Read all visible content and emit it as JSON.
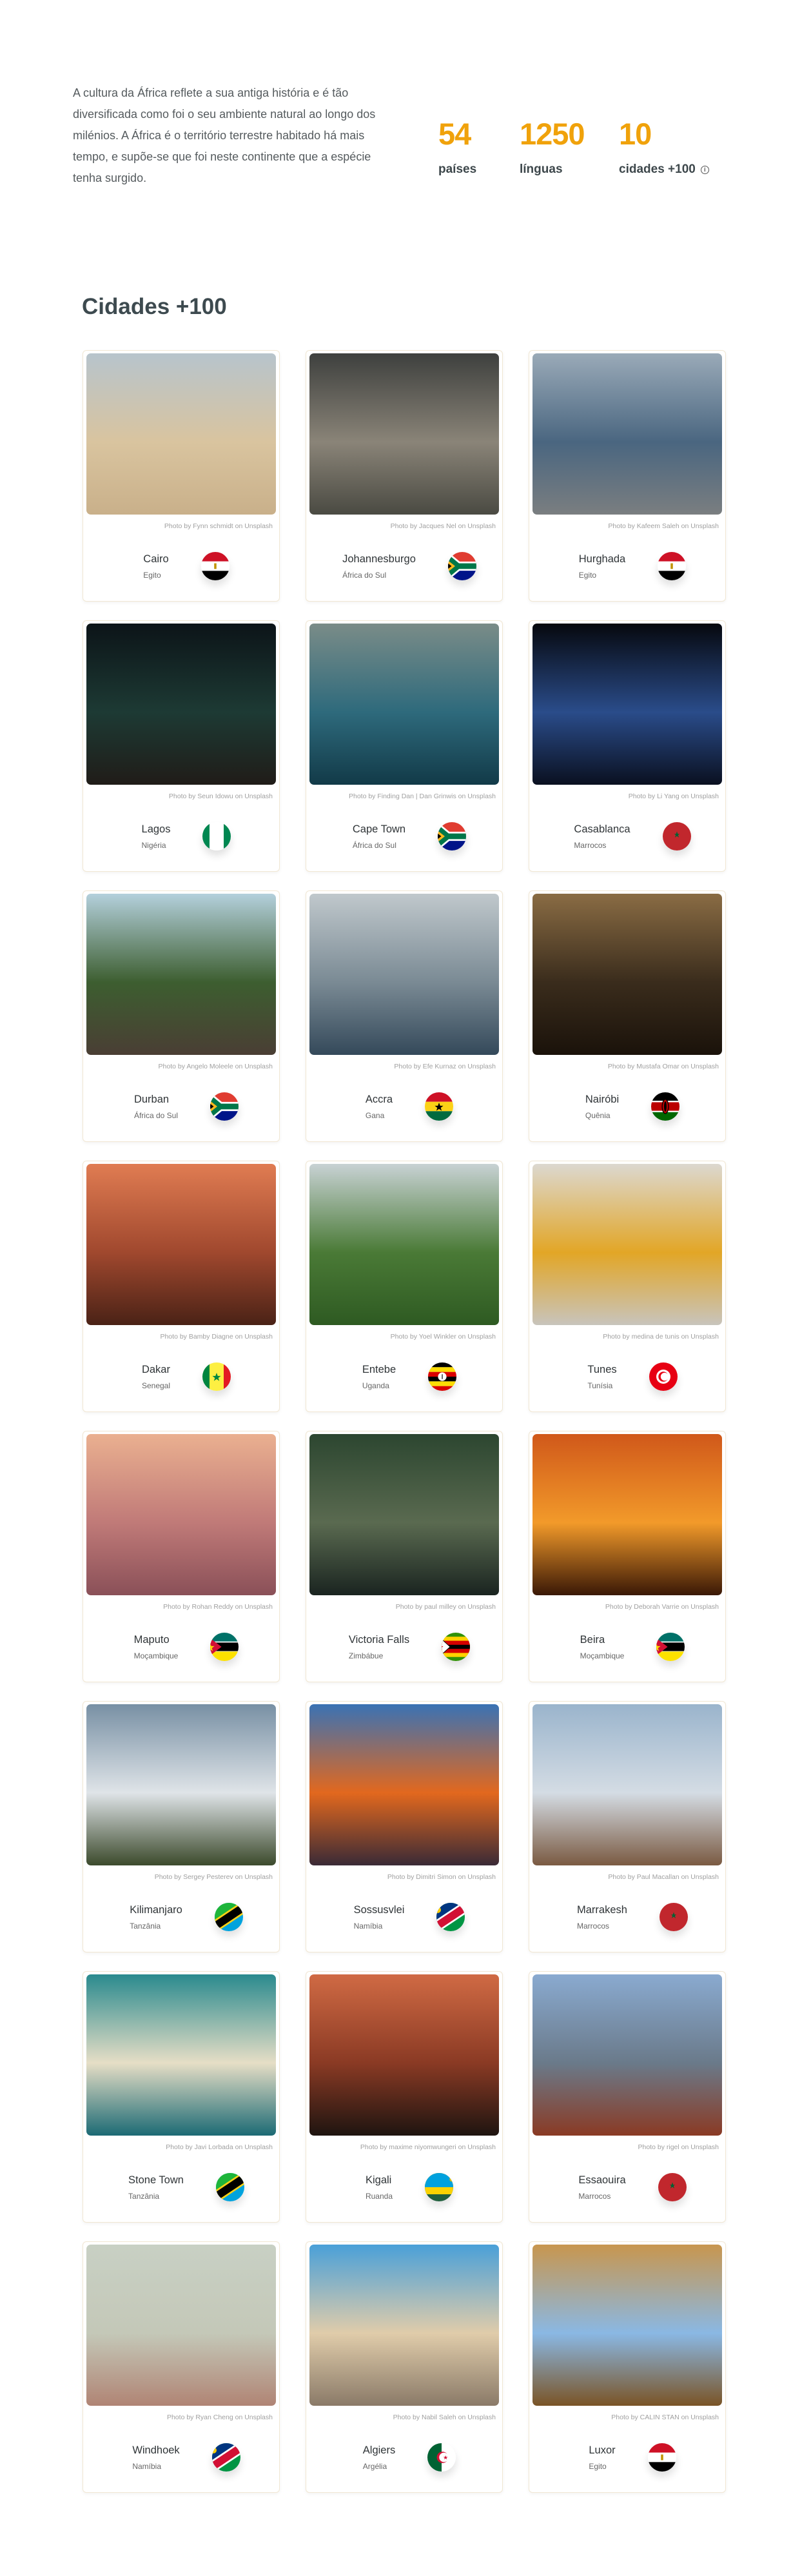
{
  "intro": {
    "text": "A cultura da África reflete a sua antiga história e é tão diversificada como foi o seu ambiente natural ao longo dos milénios. A África é o território terrestre habitado há mais tempo, e supõe-se que foi neste continente que a espécie tenha surgido."
  },
  "stats": [
    {
      "value": "54",
      "label": "países"
    },
    {
      "value": "1250",
      "label": "línguas"
    },
    {
      "value": "10",
      "label": "cidades +100",
      "icon": "info-icon"
    }
  ],
  "accent_color": "#f0a20b",
  "section_title": "Cidades +100",
  "cards": [
    {
      "city": "Cairo",
      "country": "Egito",
      "flag": "eg",
      "credit": "Photo by Fynn schmidt on Unsplash",
      "tones": [
        "#b7c4cc",
        "#d9c49f",
        "#c9b08a"
      ]
    },
    {
      "city": "Johannesburgo",
      "country": "África do Sul",
      "flag": "za",
      "credit": "Photo by Jacques Nel on Unsplash",
      "tones": [
        "#3e403e",
        "#8a8478",
        "#4a4a42"
      ]
    },
    {
      "city": "Hurghada",
      "country": "Egito",
      "flag": "eg",
      "credit": "Photo by Kafeem Saleh on Unsplash",
      "tones": [
        "#9aaab8",
        "#4a6680",
        "#7a7e80"
      ]
    },
    {
      "city": "Lagos",
      "country": "Nigéria",
      "flag": "ng",
      "credit": "Photo by Seun Idowu on Unsplash",
      "tones": [
        "#0c1418",
        "#1d3a34",
        "#201c18"
      ]
    },
    {
      "city": "Cape Town",
      "country": "África do Sul",
      "flag": "za",
      "credit": "Photo by Finding Dan | Dan Grinwis on Unsplash",
      "tones": [
        "#7a8c88",
        "#2e6a7c",
        "#123a48"
      ]
    },
    {
      "city": "Casablanca",
      "country": "Marrocos",
      "flag": "ma",
      "credit": "Photo by Li Yang on Unsplash",
      "tones": [
        "#06080e",
        "#2a4c8a",
        "#0a1020"
      ]
    },
    {
      "city": "Durban",
      "country": "África do Sul",
      "flag": "za",
      "credit": "Photo by Angelo Moleele on Unsplash",
      "tones": [
        "#b4d0dc",
        "#3d5e30",
        "#4a3e34"
      ]
    },
    {
      "city": "Accra",
      "country": "Gana",
      "flag": "gh",
      "credit": "Photo by Efe Kurnaz on Unsplash",
      "tones": [
        "#c0c8cc",
        "#7a8a94",
        "#34495a"
      ]
    },
    {
      "city": "Nairóbi",
      "country": "Quênia",
      "flag": "ke",
      "credit": "Photo by Mustafa Omar on Unsplash",
      "tones": [
        "#8a6c44",
        "#3a2c1c",
        "#1a120a"
      ]
    },
    {
      "city": "Dakar",
      "country": "Senegal",
      "flag": "sn",
      "credit": "Photo by Bamby Diagne on Unsplash",
      "tones": [
        "#e07c52",
        "#a0482e",
        "#4a2216"
      ]
    },
    {
      "city": "Entebe",
      "country": "Uganda",
      "flag": "ug",
      "credit": "Photo by Yoel Winkler on Unsplash",
      "tones": [
        "#c8d2d4",
        "#4a7a36",
        "#2e5a22"
      ]
    },
    {
      "city": "Tunes",
      "country": "Tunísia",
      "flag": "tn",
      "credit": "Photo by medina de tunis on Unsplash",
      "tones": [
        "#dcd8d0",
        "#e2a626",
        "#c8c4bc"
      ]
    },
    {
      "city": "Maputo",
      "country": "Moçambique",
      "flag": "mz",
      "credit": "Photo by Rohan Reddy on Unsplash",
      "tones": [
        "#eab090",
        "#c07a78",
        "#8a5058"
      ]
    },
    {
      "city": "Victoria Falls",
      "country": "Zimbábue",
      "flag": "zw",
      "credit": "Photo by paul milley on Unsplash",
      "tones": [
        "#2c4630",
        "#5a6a50",
        "#1a2420"
      ]
    },
    {
      "city": "Beira",
      "country": "Moçambique",
      "flag": "mz",
      "credit": "Photo by Deborah Varrie on Unsplash",
      "tones": [
        "#d0581a",
        "#f29a2a",
        "#3a1806"
      ]
    },
    {
      "city": "Kilimanjaro",
      "country": "Tanzânia",
      "flag": "tz",
      "credit": "Photo by Sergey Pesterev on Unsplash",
      "tones": [
        "#7890a4",
        "#dfe4e8",
        "#3c4a2c"
      ]
    },
    {
      "city": "Sossusvlei",
      "country": "Namíbia",
      "flag": "na",
      "credit": "Photo by Dimitri Simon on Unsplash",
      "tones": [
        "#3a72b4",
        "#e2681e",
        "#3a2a36"
      ]
    },
    {
      "city": "Marrakesh",
      "country": "Marrocos",
      "flag": "ma",
      "credit": "Photo by Paul Macallan on Unsplash",
      "tones": [
        "#9ab4cc",
        "#d4dce4",
        "#7a5a42"
      ]
    },
    {
      "city": "Stone Town",
      "country": "Tanzânia",
      "flag": "tz",
      "credit": "Photo by Javi Lorbada on Unsplash",
      "tones": [
        "#2a8a8e",
        "#e6dec6",
        "#1c6a74"
      ]
    },
    {
      "city": "Kigali",
      "country": "Ruanda",
      "flag": "rw",
      "credit": "Photo by maxime niyomwungeri on Unsplash",
      "tones": [
        "#d06a44",
        "#8a3a24",
        "#1e1410"
      ]
    },
    {
      "city": "Essaouira",
      "country": "Marrocos",
      "flag": "ma",
      "credit": "Photo by rigel on Unsplash",
      "tones": [
        "#8aaad0",
        "#6a7a8a",
        "#8a3a24"
      ]
    },
    {
      "city": "Windhoek",
      "country": "Namíbia",
      "flag": "na",
      "credit": "Photo by Ryan Cheng on Unsplash",
      "tones": [
        "#c8d0c4",
        "#c4c8b8",
        "#b08474"
      ]
    },
    {
      "city": "Algiers",
      "country": "Argélia",
      "flag": "dz",
      "credit": "Photo by Nabil Saleh on Unsplash",
      "tones": [
        "#4aa0d8",
        "#e0ccaa",
        "#8a7a68"
      ]
    },
    {
      "city": "Luxor",
      "country": "Egito",
      "flag": "eg",
      "credit": "Photo by CALIN STAN on Unsplash",
      "tones": [
        "#c8964e",
        "#8ab8e4",
        "#7a5426"
      ]
    }
  ]
}
